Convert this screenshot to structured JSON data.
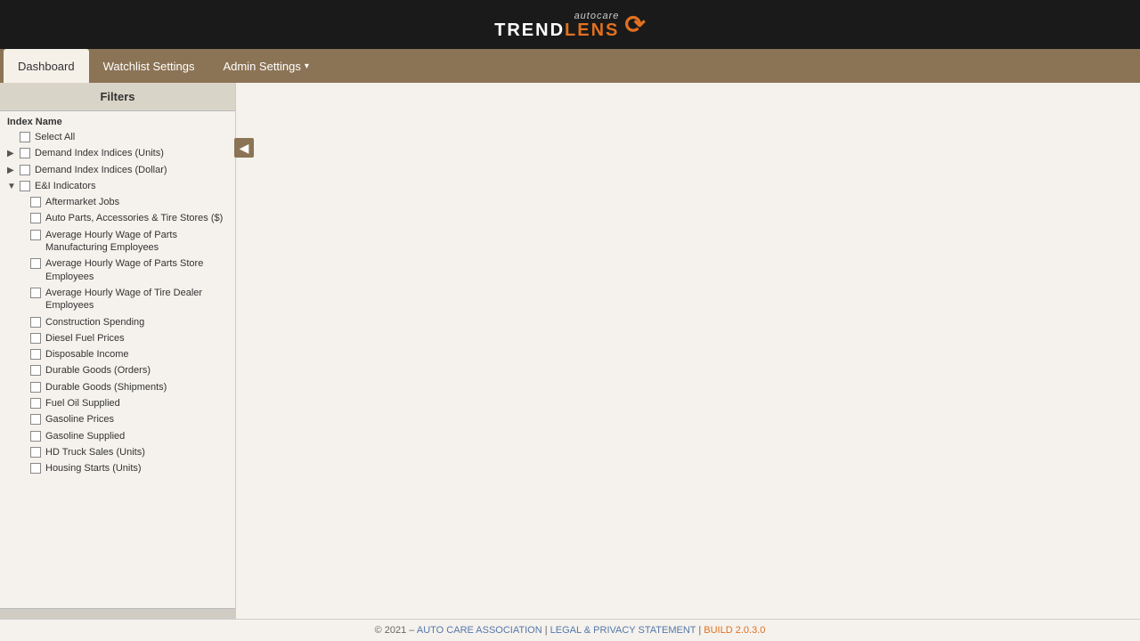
{
  "logo": {
    "line1": "autocare",
    "line2_main": "TREND",
    "line2_accent": "LENS",
    "icon": "📈"
  },
  "nav": {
    "items": [
      {
        "id": "dashboard",
        "label": "Dashboard",
        "active": true,
        "dropdown": false
      },
      {
        "id": "watchlist",
        "label": "Watchlist Settings",
        "active": false,
        "dropdown": false
      },
      {
        "id": "admin",
        "label": "Admin Settings",
        "active": false,
        "dropdown": true
      }
    ]
  },
  "sidebar": {
    "header": "Filters",
    "section_label": "Index Name",
    "tree": [
      {
        "id": "select-all",
        "label": "Select All",
        "indent": 0,
        "toggle": null,
        "level": "top"
      },
      {
        "id": "demand-units",
        "label": "Demand Index Indices (Units)",
        "indent": 0,
        "toggle": "▶",
        "level": "top"
      },
      {
        "id": "demand-dollar",
        "label": "Demand Index Indices (Dollar)",
        "indent": 0,
        "toggle": "▶",
        "level": "top"
      },
      {
        "id": "ei-indicators",
        "label": "E&I Indicators",
        "indent": 0,
        "toggle": "▼",
        "level": "top",
        "expanded": true
      },
      {
        "id": "aftermarket-jobs",
        "label": "Aftermarket Jobs",
        "indent": 1,
        "toggle": null,
        "level": "child"
      },
      {
        "id": "auto-parts",
        "label": "Auto Parts, Accessories & Tire Stores ($)",
        "indent": 1,
        "toggle": null,
        "level": "child"
      },
      {
        "id": "avg-hourly-parts-mfg",
        "label": "Average Hourly Wage of Parts Manufacturing Employees",
        "indent": 1,
        "toggle": null,
        "level": "child"
      },
      {
        "id": "avg-hourly-parts-store",
        "label": "Average Hourly Wage of Parts Store Employees",
        "indent": 1,
        "toggle": null,
        "level": "child"
      },
      {
        "id": "avg-hourly-tire-dealer",
        "label": "Average Hourly Wage of Tire Dealer Employees",
        "indent": 1,
        "toggle": null,
        "level": "child"
      },
      {
        "id": "construction-spending",
        "label": "Construction Spending",
        "indent": 1,
        "toggle": null,
        "level": "child"
      },
      {
        "id": "diesel-fuel",
        "label": "Diesel Fuel Prices",
        "indent": 1,
        "toggle": null,
        "level": "child"
      },
      {
        "id": "disposable-income",
        "label": "Disposable Income",
        "indent": 1,
        "toggle": null,
        "level": "child"
      },
      {
        "id": "durable-goods-orders",
        "label": "Durable Goods (Orders)",
        "indent": 1,
        "toggle": null,
        "level": "child"
      },
      {
        "id": "durable-goods-shipments",
        "label": "Durable Goods (Shipments)",
        "indent": 1,
        "toggle": null,
        "level": "child"
      },
      {
        "id": "fuel-oil",
        "label": "Fuel Oil Supplied",
        "indent": 1,
        "toggle": null,
        "level": "child"
      },
      {
        "id": "gasoline-prices",
        "label": "Gasoline Prices",
        "indent": 1,
        "toggle": null,
        "level": "child"
      },
      {
        "id": "gasoline-supplied",
        "label": "Gasoline Supplied",
        "indent": 1,
        "toggle": null,
        "level": "child"
      },
      {
        "id": "hd-truck-sales",
        "label": "HD Truck Sales (Units)",
        "indent": 1,
        "toggle": null,
        "level": "child"
      },
      {
        "id": "housing-starts",
        "label": "Housing Starts (Units)",
        "indent": 1,
        "toggle": null,
        "level": "child"
      }
    ]
  },
  "collapse_btn": "◀",
  "footer": {
    "copyright": "© 2021 –",
    "link1": "AUTO CARE ASSOCIATION",
    "separator1": " | ",
    "link2_text": "LEGAL &",
    "link2b_text": "PRIVACY STATEMENT",
    "separator2": " | ",
    "build": "BUILD 2.0.3.0"
  }
}
